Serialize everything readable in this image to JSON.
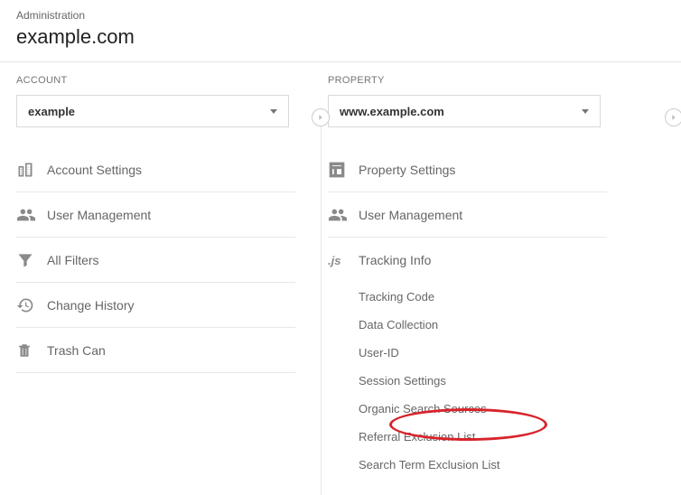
{
  "header": {
    "breadcrumb": "Administration",
    "title": "example.com"
  },
  "account": {
    "heading": "ACCOUNT",
    "selected": "example",
    "items": {
      "settings": "Account Settings",
      "user": "User Management",
      "filters": "All Filters",
      "history": "Change History",
      "trash": "Trash Can"
    }
  },
  "property": {
    "heading": "PROPERTY",
    "selected": "www.example.com",
    "items": {
      "settings": "Property Settings",
      "user": "User Management",
      "tracking": "Tracking Info"
    },
    "trackingSub": {
      "code": "Tracking Code",
      "dataCollection": "Data Collection",
      "userId": "User-ID",
      "sessionSettings": "Session Settings",
      "organic": "Organic Search Sources",
      "referral": "Referral Exclusion List",
      "searchTerm": "Search Term Exclusion List"
    }
  }
}
